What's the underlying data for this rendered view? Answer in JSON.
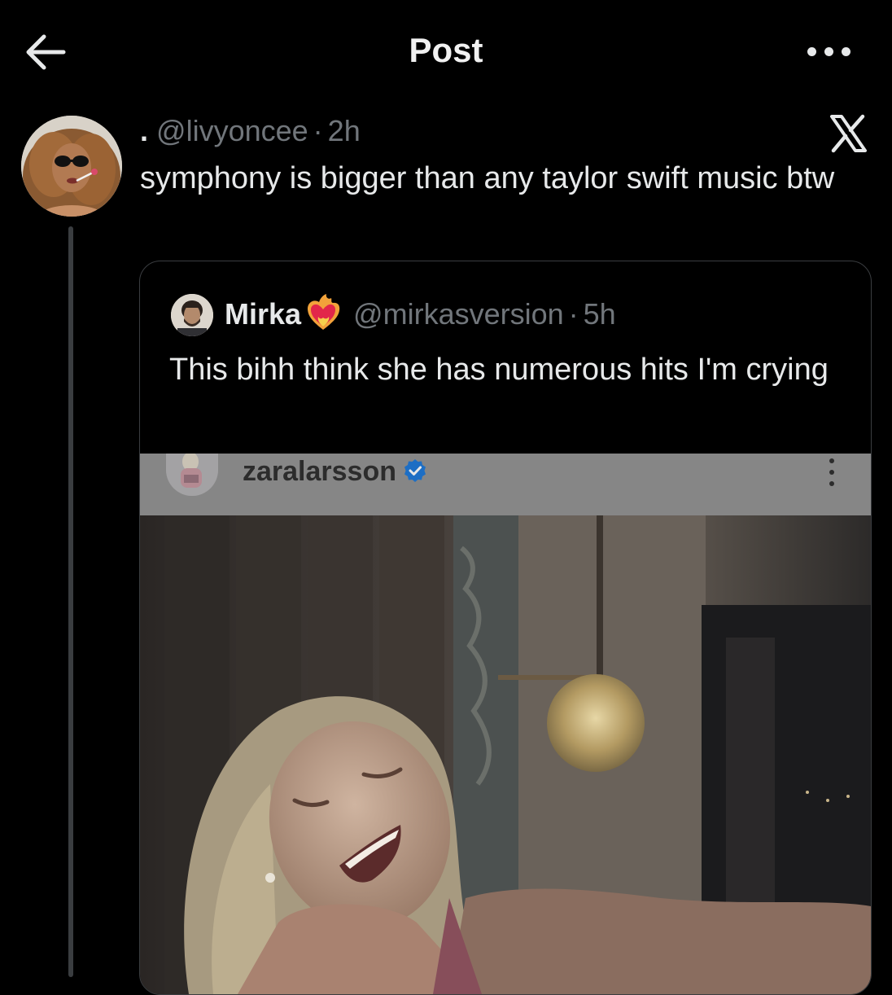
{
  "header": {
    "title": "Post",
    "back_icon": "arrow-left-icon",
    "more_icon": "more-horizontal-icon"
  },
  "post": {
    "display_name": ".",
    "handle": "@livyoncee",
    "separator": "·",
    "time": "2h",
    "text": "symphony is bigger than any taylor swift music btw",
    "platform_icon": "x-logo-icon"
  },
  "quote": {
    "display_name": "Mirka",
    "name_emoji": "heart-on-fire-icon",
    "handle": "@mirkasversion",
    "separator": "·",
    "time": "5h",
    "text": "This bihh think she has numerous hits I'm crying"
  },
  "media": {
    "ig_username": "zaralarsson",
    "verified_icon": "verified-badge-icon",
    "more_icon": "more-vertical-icon",
    "photo": "photo-laughing-woman"
  },
  "colors": {
    "background": "#000000",
    "text_primary": "#e7e9ea",
    "text_secondary": "#71767b",
    "border": "#3a3d40",
    "verified": "#1d9bf0",
    "ig_bar": "#868686"
  }
}
